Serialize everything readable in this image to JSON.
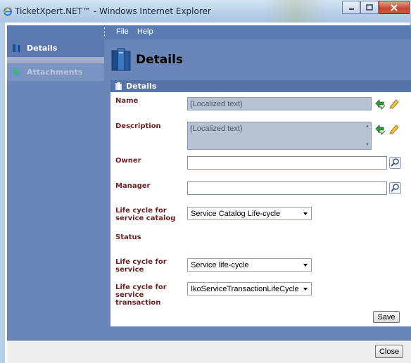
{
  "window": {
    "title": "TicketXpert.NET™ - Windows Internet Explorer",
    "minimize_icon": "minimize-icon",
    "maximize_icon": "maximize-icon",
    "close_icon": "close-icon"
  },
  "menu": {
    "items": [
      {
        "label": "File"
      },
      {
        "label": "Help"
      }
    ]
  },
  "sidebar": {
    "items": [
      {
        "label": "Details",
        "icon": "book-icon",
        "active": true
      },
      {
        "label": "Attachments",
        "icon": "globe-icon",
        "active": false
      }
    ]
  },
  "page": {
    "title": "Details",
    "icon": "books-icon"
  },
  "panel": {
    "title": "Details"
  },
  "form": {
    "name": {
      "label": "Name",
      "value": "(Localized text)"
    },
    "description": {
      "label": "Description",
      "value": "(Localized text)"
    },
    "owner": {
      "label": "Owner",
      "value": ""
    },
    "manager": {
      "label": "Manager",
      "value": ""
    },
    "lc_catalog": {
      "label": "Life cycle for service catalog",
      "value": "Service Catalog Life-cycle"
    },
    "status": {
      "label": "Status"
    },
    "lc_service": {
      "label": "Life cycle for service",
      "value": "Service life-cycle"
    },
    "lc_transaction": {
      "label": "Life cycle for service transaction",
      "value": "IkoServiceTransactionLifeCycle"
    }
  },
  "buttons": {
    "save": "Save",
    "close": "Close"
  },
  "colors": {
    "accent": "#5d7bb3",
    "panel_header": "#5873a6",
    "label": "#6b1f1f"
  }
}
